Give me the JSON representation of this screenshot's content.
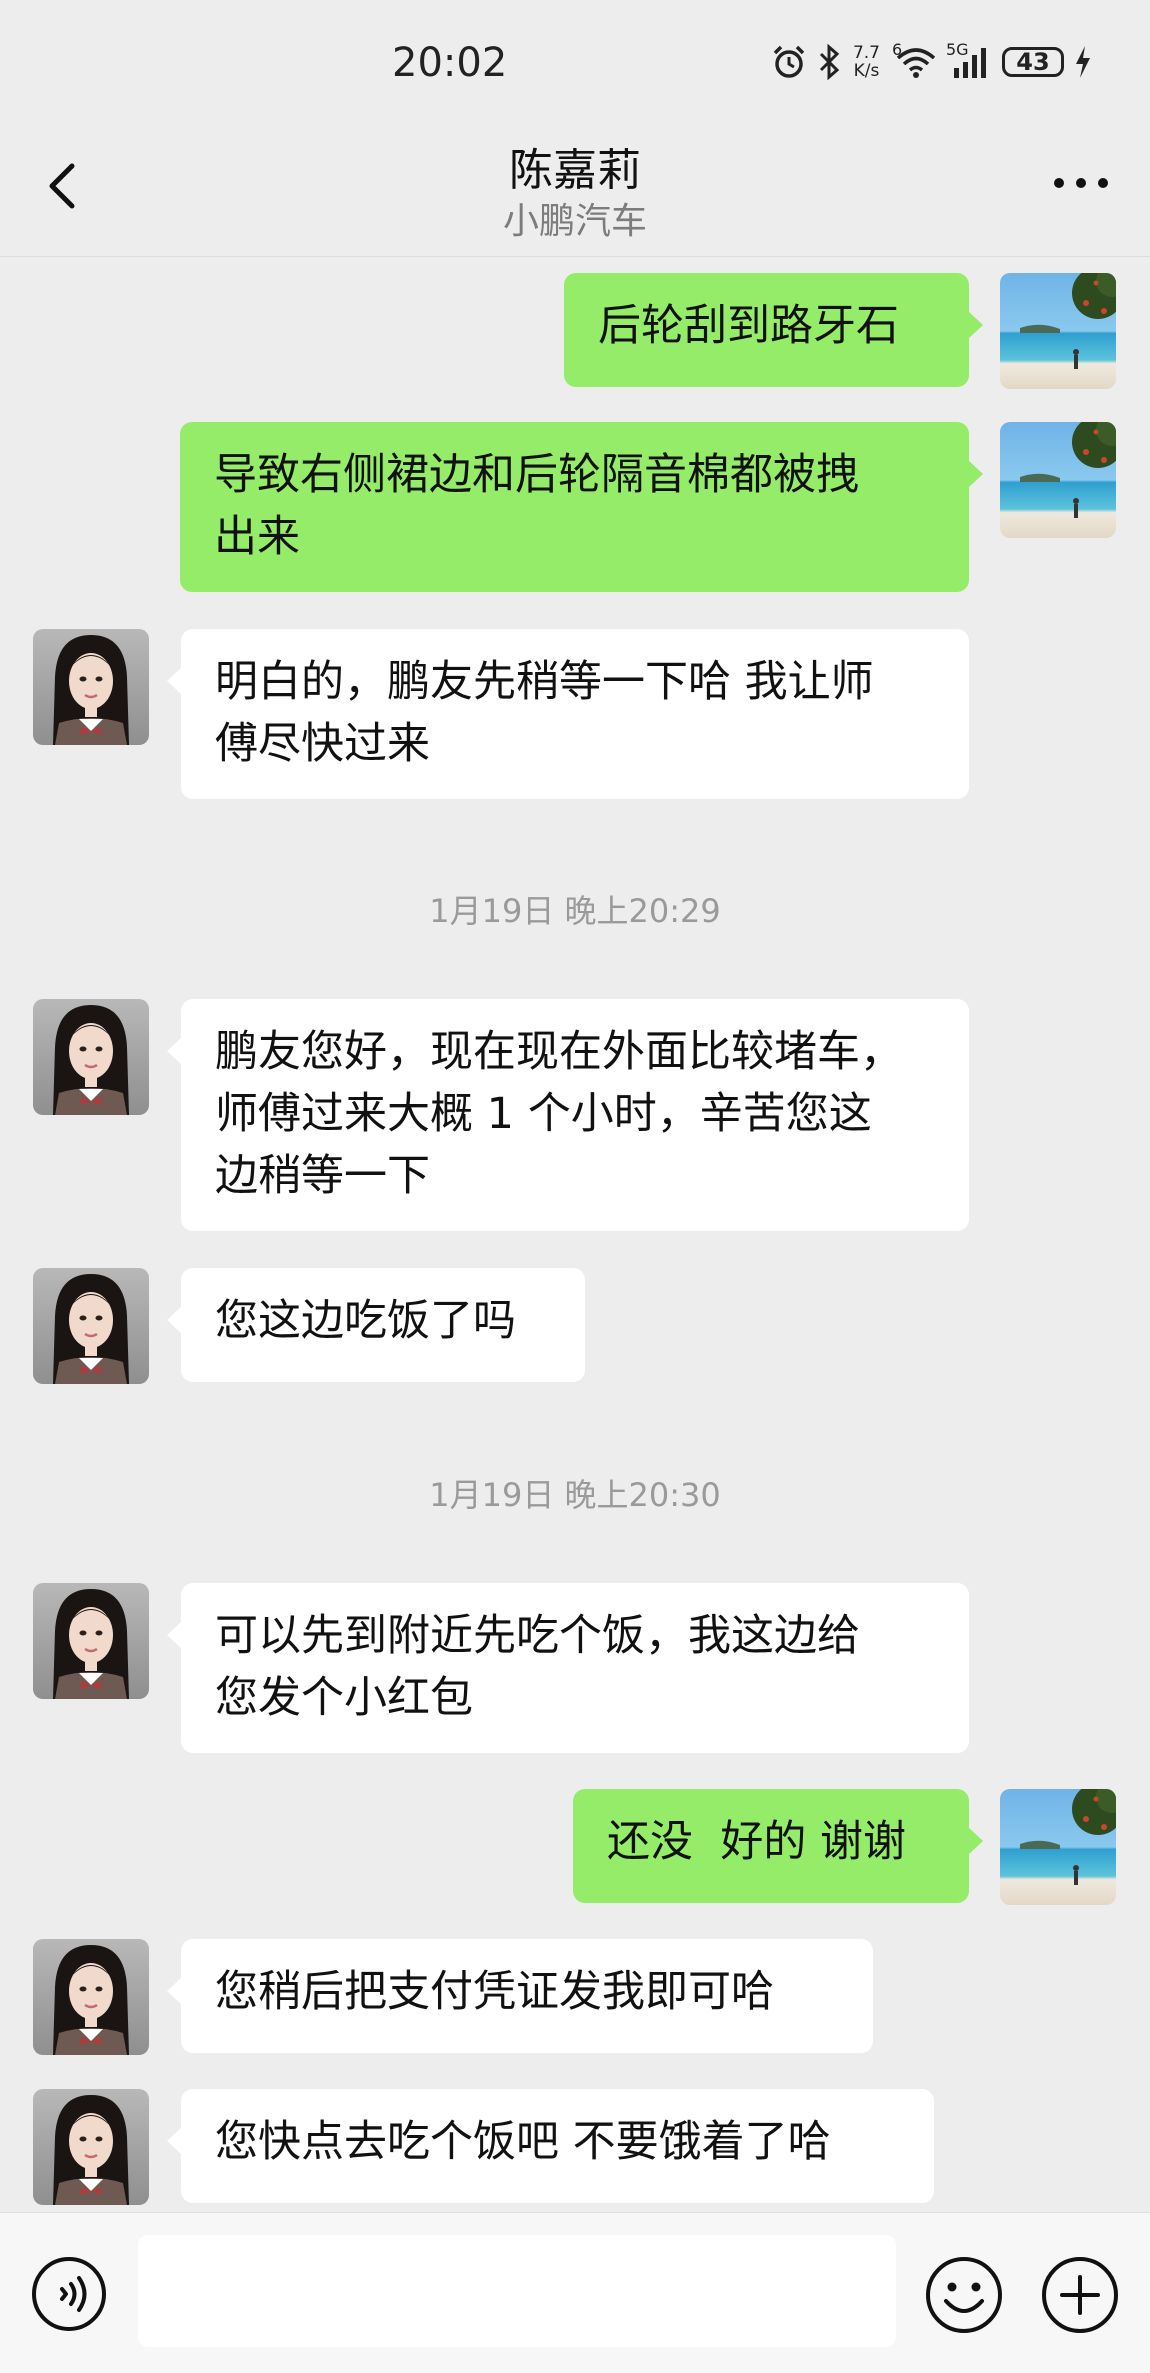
{
  "status_bar": {
    "time": "20:02",
    "net_speed_value": "7.7",
    "net_speed_unit": "K/s",
    "wifi_badge": "6",
    "cell_badge": "5G",
    "battery": "43"
  },
  "header": {
    "title": "陈嘉莉",
    "subtitle": "小鹏汽车"
  },
  "messages": [
    {
      "kind": "out",
      "text": "后轮刮到路牙石"
    },
    {
      "kind": "out",
      "text": "导致右侧裙边和后轮隔音棉都被拽\n出来"
    },
    {
      "kind": "in",
      "text": "明白的，鹏友先稍等一下哈 我让师\n傅尽快过来"
    },
    {
      "kind": "time",
      "text": "1月19日 晚上20:29"
    },
    {
      "kind": "in",
      "text": "鹏友您好，现在现在外面比较堵车，\n师傅过来大概 1 个小时，辛苦您这\n边稍等一下"
    },
    {
      "kind": "in",
      "text": "您这边吃饭了吗"
    },
    {
      "kind": "time",
      "text": "1月19日 晚上20:30"
    },
    {
      "kind": "in",
      "text": "可以先到附近先吃个饭，我这边给\n您发个小红包"
    },
    {
      "kind": "out",
      "text": "还没  好的 谢谢"
    },
    {
      "kind": "in",
      "text": "您稍后把支付凭证发我即可哈"
    },
    {
      "kind": "in",
      "text": "您快点去吃个饭吧 不要饿着了哈"
    }
  ],
  "input_bar": {
    "placeholder": ""
  },
  "icons": {
    "back": "chevron-left-icon",
    "more": "more-dots-icon",
    "voice": "voice-icon",
    "emoji": "emoji-icon",
    "plus": "plus-icon"
  },
  "colors": {
    "background": "#ededed",
    "outgoing_bubble": "#95ec69",
    "incoming_bubble": "#ffffff",
    "timestamp_text": "#9a9a9a"
  }
}
